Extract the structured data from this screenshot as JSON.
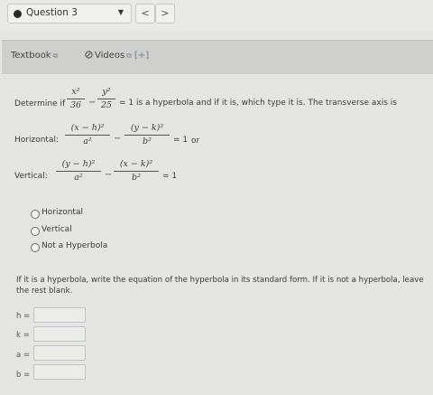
{
  "header": {
    "question_label": "Question 3",
    "prev_symbol": "<",
    "next_symbol": ">",
    "caret_symbol": "▼"
  },
  "resources": {
    "textbook_label": "Textbook",
    "videos_label": "Videos",
    "more_label": "[+]",
    "external_symbol": "⧉"
  },
  "problem": {
    "intro_text": "Determine if",
    "eq_x_num": "x²",
    "eq_x_den": "36",
    "eq_y_num": "y²",
    "eq_y_den": "25",
    "minus": "−",
    "statement_text": "= 1 is a hyperbola and if it is, which type it is.  The transverse axis is",
    "horizontal_label": "Horizontal:",
    "h_num1": "(x − h)²",
    "h_den1": "a²",
    "h_num2": "(y − k)²",
    "h_den2": "b²",
    "h_equals": "= 1",
    "or_text": "or",
    "vertical_label": "Vertical:",
    "v_num1": "(y − h)²",
    "v_den1": "a²",
    "v_num2": "(x − k)²",
    "v_den2": "b²",
    "v_equals": "= 1"
  },
  "options": [
    {
      "label": "Horizontal"
    },
    {
      "label": "Vertical"
    },
    {
      "label": "Not a Hyperbola"
    }
  ],
  "instructions": {
    "line1": "If it is a hyperbola, write the equation of the hyperbola in its standard form.  If it is not a hyperbola, leave",
    "line2": "the rest blank."
  },
  "fields": {
    "h_label": "h =",
    "h_value": "",
    "k_label": "k =",
    "k_value": "",
    "a_label": "a =",
    "a_value": "",
    "b_label": "b =",
    "b_value": ""
  }
}
